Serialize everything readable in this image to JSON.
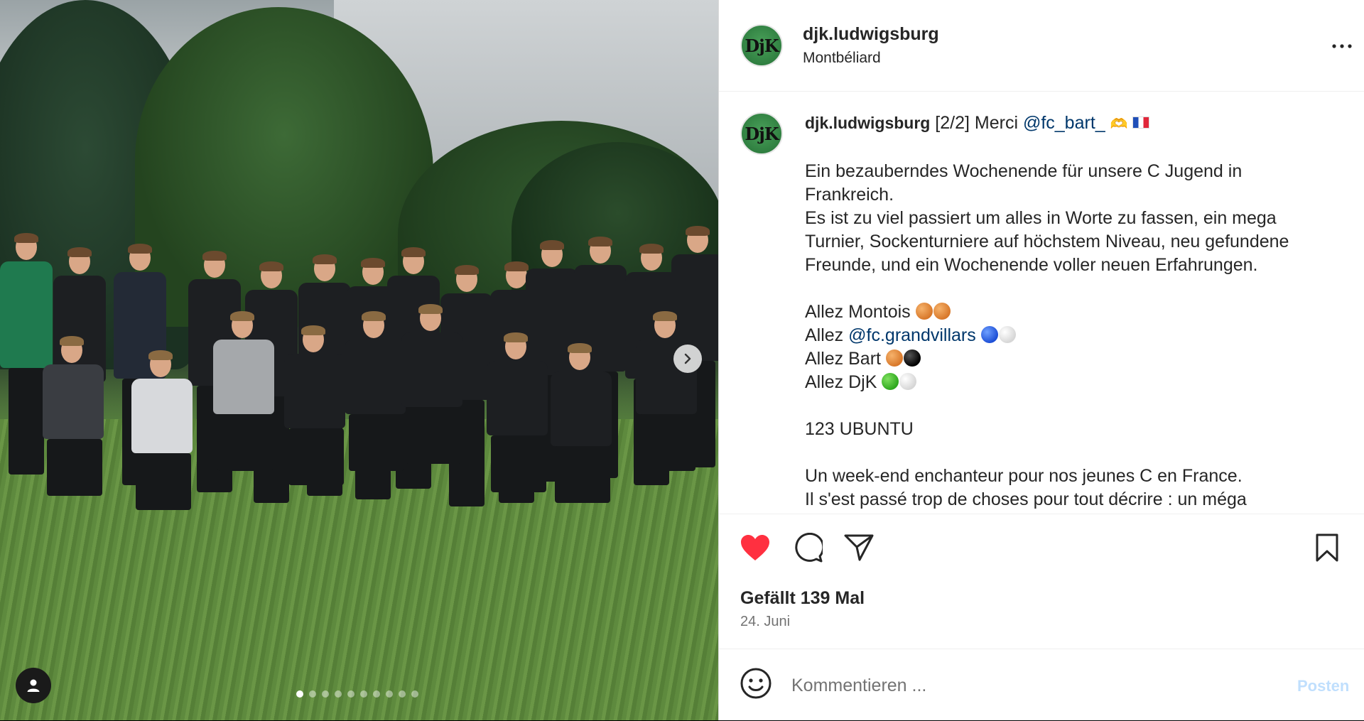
{
  "post": {
    "username": "djk.ludwigsburg",
    "location": "Montbéliard",
    "avatar_text": "DjK"
  },
  "caption": {
    "username": "djk.ludwigsburg",
    "first_line_text": "[2/2] Merci",
    "mention_1": "@fc_bart_",
    "paragraph_de_1": "Ein bezauberndes Wochenende für unsere C Jugend in Frankreich.",
    "paragraph_de_2": "Es ist zu viel passiert um alles in Worte zu fassen, ein mega Turnier, Sockenturniere auf höchstem Niveau, neu gefundene Freunde, und ein Wochenende voller neuen Erfahrungen.",
    "allez_montois": "Allez Montois",
    "allez_prefix": "Allez",
    "mention_2": "@fc.grandvillars",
    "allez_bart": "Allez Bart",
    "allez_djk": "Allez DjK",
    "ubuntu": "123 UBUNTU",
    "paragraph_fr_1": "Un week-end enchanteur pour nos jeunes C en France.",
    "paragraph_fr_2": "Il s'est passé trop de choses pour tout décrire : un méga"
  },
  "engagement": {
    "likes": "Gefällt 139 Mal",
    "date": "24. Juni"
  },
  "comment": {
    "placeholder": "Kommentieren ...",
    "post_label": "Posten"
  },
  "carousel": {
    "total_slides": 10,
    "active_slide": 1
  },
  "colors": {
    "like_red": "#ff3040",
    "mention_blue": "#00376b",
    "post_disabled": "#c0dffd"
  },
  "icons": {
    "more": "more-options-icon",
    "like": "heart-filled-icon",
    "comment": "comment-icon",
    "share": "share-icon",
    "save": "bookmark-icon",
    "emoji": "emoji-icon",
    "next": "chevron-right-icon",
    "tag": "user-tag-icon"
  }
}
